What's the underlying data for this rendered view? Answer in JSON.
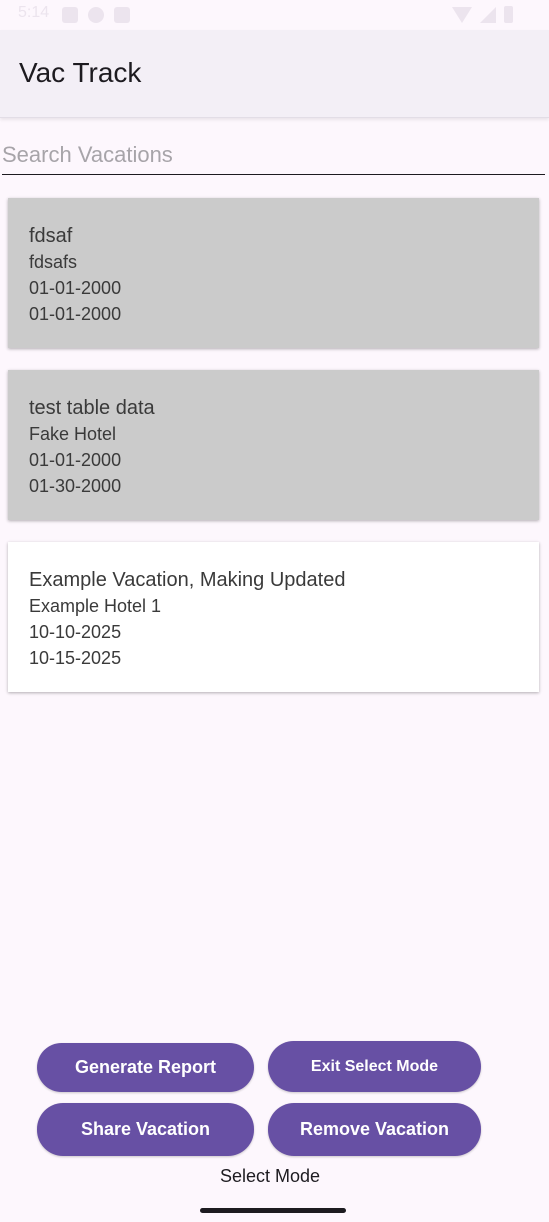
{
  "status_bar": {
    "time": "5:14"
  },
  "app_bar": {
    "title": "Vac Track"
  },
  "search": {
    "placeholder": "Search Vacations",
    "value": ""
  },
  "vacations": [
    {
      "title": "fdsaf",
      "hotel": "fdsafs",
      "start_date": "01-01-2000",
      "end_date": "01-01-2000",
      "selected": true
    },
    {
      "title": "test table data",
      "hotel": "Fake Hotel",
      "start_date": "01-01-2000",
      "end_date": "01-30-2000",
      "selected": true
    },
    {
      "title": "Example Vacation, Making Updated",
      "hotel": "Example Hotel 1",
      "start_date": "10-10-2025",
      "end_date": "10-15-2025",
      "selected": false
    }
  ],
  "buttons": {
    "generate_report": "Generate Report",
    "exit_select_mode": "Exit Select Mode",
    "share_vacation": "Share Vacation",
    "remove_vacation": "Remove Vacation"
  },
  "mode_label": "Select Mode",
  "colors": {
    "primary": "#6750a4",
    "selected_card": "#cbcbcb",
    "background": "#fdf7fd",
    "app_bar": "#f3eff6"
  }
}
